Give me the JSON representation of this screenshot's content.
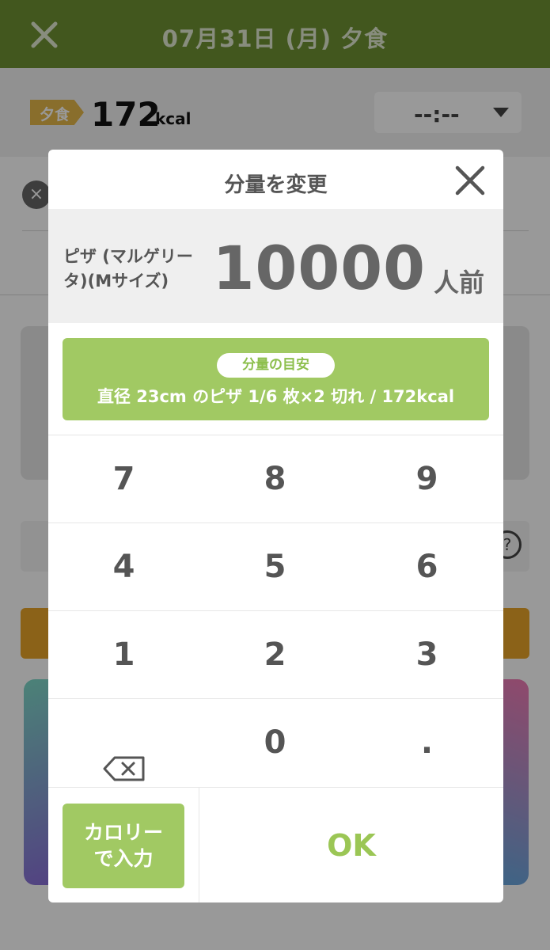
{
  "header": {
    "title": "07月31日 (月) 夕食",
    "close_icon": "close-icon"
  },
  "summary": {
    "meal_tag": "夕食",
    "kcal_value": "172",
    "kcal_unit": "kcal",
    "time_value": "--:--"
  },
  "modal": {
    "title": "分量を変更",
    "food_name": "ピザ (マルゲリータ)(Mサイズ)",
    "quantity": "10000",
    "quantity_unit": "人前",
    "hint_label": "分量の目安",
    "hint_text": "直径 23cm のピザ 1/6 枚×2 切れ / 172kcal"
  },
  "keypad": {
    "keys": [
      "7",
      "8",
      "9",
      "4",
      "5",
      "6",
      "1",
      "2",
      "3",
      "backspace",
      "0",
      "."
    ]
  },
  "buttons": {
    "calorie_input_line1": "カロリー",
    "calorie_input_line2": "で入力",
    "ok": "OK"
  },
  "colors": {
    "header_green": "#6e9232",
    "accent_green": "#a1c963",
    "ok_green": "#9bc655",
    "meal_tag_orange": "#e4b74a"
  }
}
